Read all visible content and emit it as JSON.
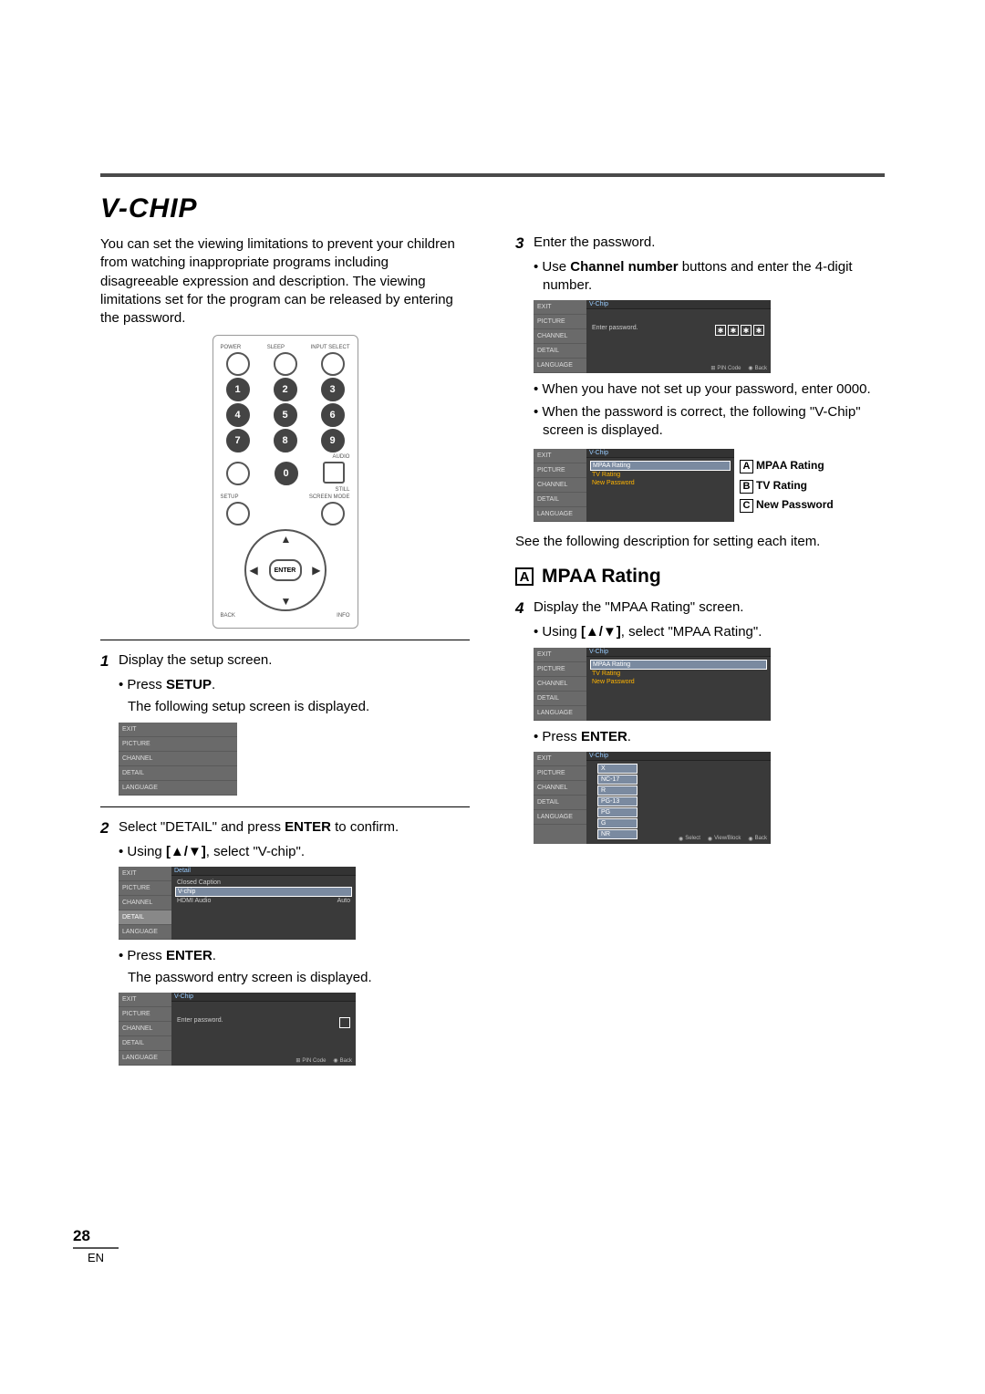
{
  "title": "V-CHIP",
  "intro": "You can set the viewing limitations to prevent your children from watching inappropriate programs including disagreeable expression and description. The viewing limitations set for the program can be released by entering the password.",
  "remote": {
    "top_labels": [
      "POWER",
      "SLEEP",
      "INPUT SELECT"
    ],
    "numpad": [
      "1",
      "2",
      "3",
      "4",
      "5",
      "6",
      "7",
      "8",
      "9",
      "0"
    ],
    "right_labels": [
      "AUDIO",
      "STILL"
    ],
    "bottom_left": "SETUP",
    "bottom_right": "SCREEN MODE",
    "enter": "ENTER",
    "back": "BACK",
    "info": "INFO"
  },
  "step1": {
    "num": "1",
    "text": "Display the setup screen.",
    "b1_pre": "• Press ",
    "b1_bold": "SETUP",
    "b1_post": ".",
    "b2": "The following setup screen is displayed."
  },
  "osd_side": [
    "EXIT",
    "PICTURE",
    "CHANNEL",
    "DETAIL",
    "LANGUAGE"
  ],
  "step2": {
    "num": "2",
    "text_pre": "Select \"DETAIL\" and press ",
    "text_bold": "ENTER",
    "text_post": " to confirm.",
    "b1_pre": "• Using ",
    "b1_bold": "[▲/▼]",
    "b1_post": ", select \"V-chip\"."
  },
  "osd_detail": {
    "header": "Detail",
    "rows": [
      [
        "Closed Caption",
        ""
      ],
      [
        "V-chip",
        ""
      ],
      [
        "HDMI Audio",
        "Auto"
      ]
    ],
    "hl": 1
  },
  "step2b": {
    "b1_pre": "• Press ",
    "b1_bold": "ENTER",
    "b1_post": ".",
    "b2": "The password entry screen is displayed."
  },
  "osd_pw": {
    "header": "V-Chip",
    "prompt": "Enter password.",
    "foot": [
      "PIN Code",
      "Back"
    ]
  },
  "step3": {
    "num": "3",
    "text": "Enter the password.",
    "b1_pre": "• Use ",
    "b1_bold": "Channel number",
    "b1_post": " buttons and enter the 4-digit number."
  },
  "step3b": {
    "b1": "• When you have not set up your password, enter 0000.",
    "b2": "• When the password is correct, the following \"V-Chip\" screen is displayed."
  },
  "osd_vchip_menu": {
    "header": "V-Chip",
    "rows": [
      "MPAA Rating",
      "TV Rating",
      "New Password"
    ],
    "hl": 0
  },
  "callout_labels": {
    "a": "MPAA Rating",
    "b": "TV Rating",
    "c": "New Password"
  },
  "see_desc": "See the following description for setting each item.",
  "sectionA": {
    "letter": "A",
    "title": "MPAA Rating"
  },
  "step4": {
    "num": "4",
    "text": "Display the \"MPAA Rating\" screen.",
    "b1_pre": "• Using ",
    "b1_bold": "[▲/▼]",
    "b1_post": ", select \"MPAA Rating\"."
  },
  "step4b": {
    "b1_pre": "• Press ",
    "b1_bold": "ENTER",
    "b1_post": "."
  },
  "osd_ratings": {
    "header": "V-Chip",
    "ratings": [
      "X",
      "NC-17",
      "R",
      "PG-13",
      "PG",
      "G",
      "NR"
    ],
    "foot": [
      "Select",
      "View/Block",
      "Back"
    ]
  },
  "page_number": "28",
  "page_lang": "EN"
}
